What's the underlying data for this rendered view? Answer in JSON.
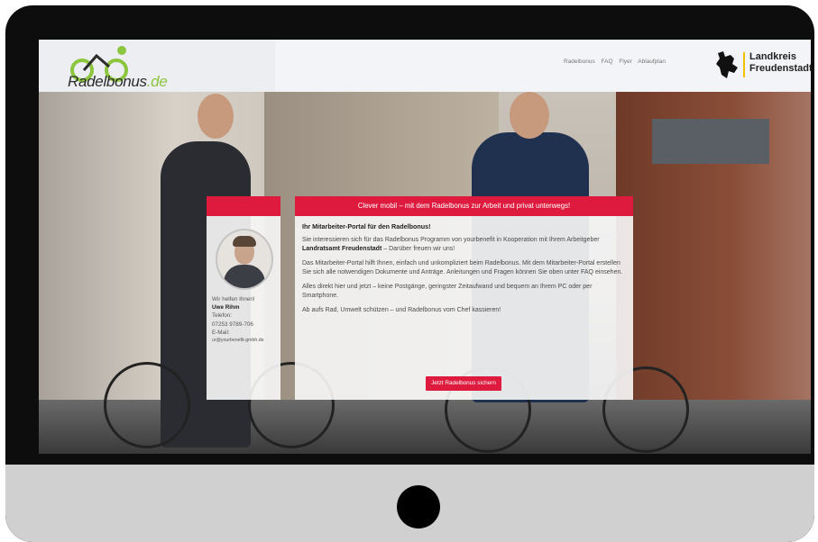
{
  "header": {
    "logo": {
      "text": "Radelbonus",
      "tld": ".de"
    },
    "nav": [
      "Radelbonus",
      "FAQ",
      "Flyer",
      "Ablaufplan"
    ],
    "partner": {
      "line1": "Landkreis",
      "line2": "Freudenstadt"
    }
  },
  "contact": {
    "line1": "Wir helfen Ihnen!",
    "name": "Uwe Rihm",
    "phone_label": "Telefon:",
    "phone": "07253 9789-706",
    "email_label": "E-Mail:",
    "email": "ur@yourbenefit-gmbh.de"
  },
  "main": {
    "banner": "Clever mobil – mit dem Radelbonus zur Arbeit und privat unterwegs!",
    "heading": "Ihr Mitarbeiter-Portal für den Radelbonus!",
    "p1_a": "Sie interessieren sich für das Radelbonus Programm von yourbenefit in Kooperation mit Ihrem Arbeitgeber ",
    "p1_b": "Landratsamt Freudenstadt",
    "p1_c": " – Darüber freuen wir uns!",
    "p2": "Das Mitarbeiter-Portal hilft Ihnen, einfach und unkompliziert beim Radelbonus. Mit dem Mitarbeiter-Portal erstellen Sie sich alle notwendigen Dokumente und Anträge. Anleitungen und Fragen können Sie oben unter FAQ einsehen.",
    "p3": "Alles direkt hier und jetzt – keine Postgänge, geringster Zeitaufwand und bequem an Ihrem PC oder per Smartphone.",
    "p4": "Ab aufs Rad, Umwelt schützen – und Radelbonus vom Chef kassieren!",
    "cta": "Jetzt Radelbonus sichern"
  },
  "colors": {
    "accent": "#de1b3e",
    "logo_green": "#8cc63f",
    "partner_yellow": "#f2c200"
  }
}
